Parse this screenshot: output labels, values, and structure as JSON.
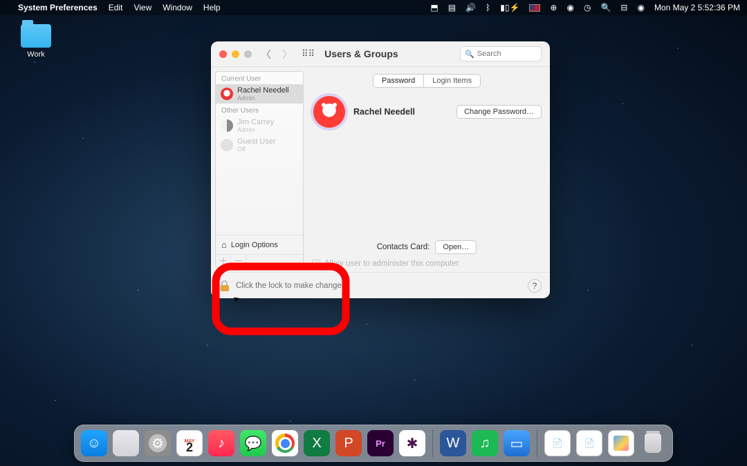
{
  "menubar": {
    "app": "System Preferences",
    "menus": [
      "Edit",
      "View",
      "Window",
      "Help"
    ],
    "clock": "Mon May 2  5:52:36 PM"
  },
  "desktop": {
    "folder_label": "Work"
  },
  "window": {
    "title": "Users & Groups",
    "search_placeholder": "Search",
    "tabs": {
      "password": "Password",
      "login_items": "Login Items"
    },
    "sidebar": {
      "current_head": "Current User",
      "other_head": "Other Users",
      "users": [
        {
          "name": "Rachel Needell",
          "role": "Admin"
        },
        {
          "name": "Jim Carrey",
          "role": "Admin"
        },
        {
          "name": "Guest User",
          "role": "Off"
        }
      ],
      "login_options": "Login Options"
    },
    "main": {
      "user_name": "Rachel Needell",
      "change_password": "Change Password…",
      "contacts_label": "Contacts Card:",
      "open": "Open…",
      "admin_check": "Allow user to administer this computer"
    },
    "footer": {
      "lock_text": "Click the lock to make changes."
    }
  },
  "dock": {
    "cal_month": "MAY",
    "cal_day": "2",
    "premiere": "Pr"
  }
}
